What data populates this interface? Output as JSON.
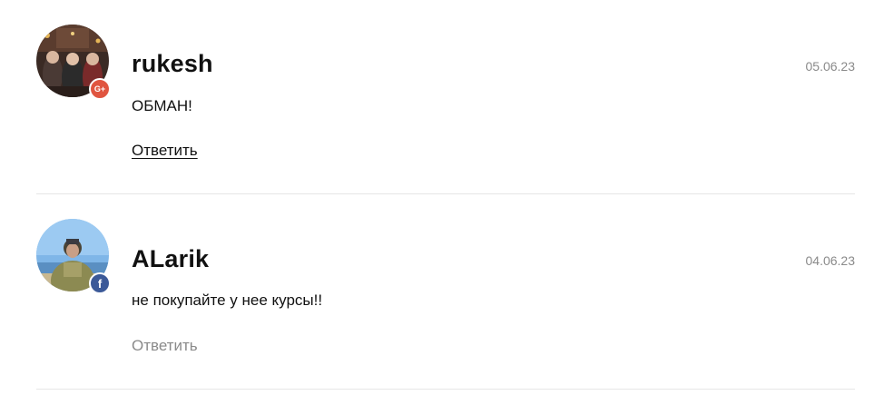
{
  "comments": [
    {
      "author": "rukesh",
      "date": "05.06.23",
      "text": "ОБМАН!",
      "reply_label": "Ответить",
      "social": {
        "icon": "google-plus-icon",
        "glyph": "G+",
        "color": "#e05540"
      }
    },
    {
      "author": "ALarik",
      "date": "04.06.23",
      "text": "не покупайте у нее курсы!!",
      "reply_label": "Ответить",
      "social": {
        "icon": "facebook-icon",
        "glyph": "f",
        "color": "#3b5998"
      }
    }
  ]
}
